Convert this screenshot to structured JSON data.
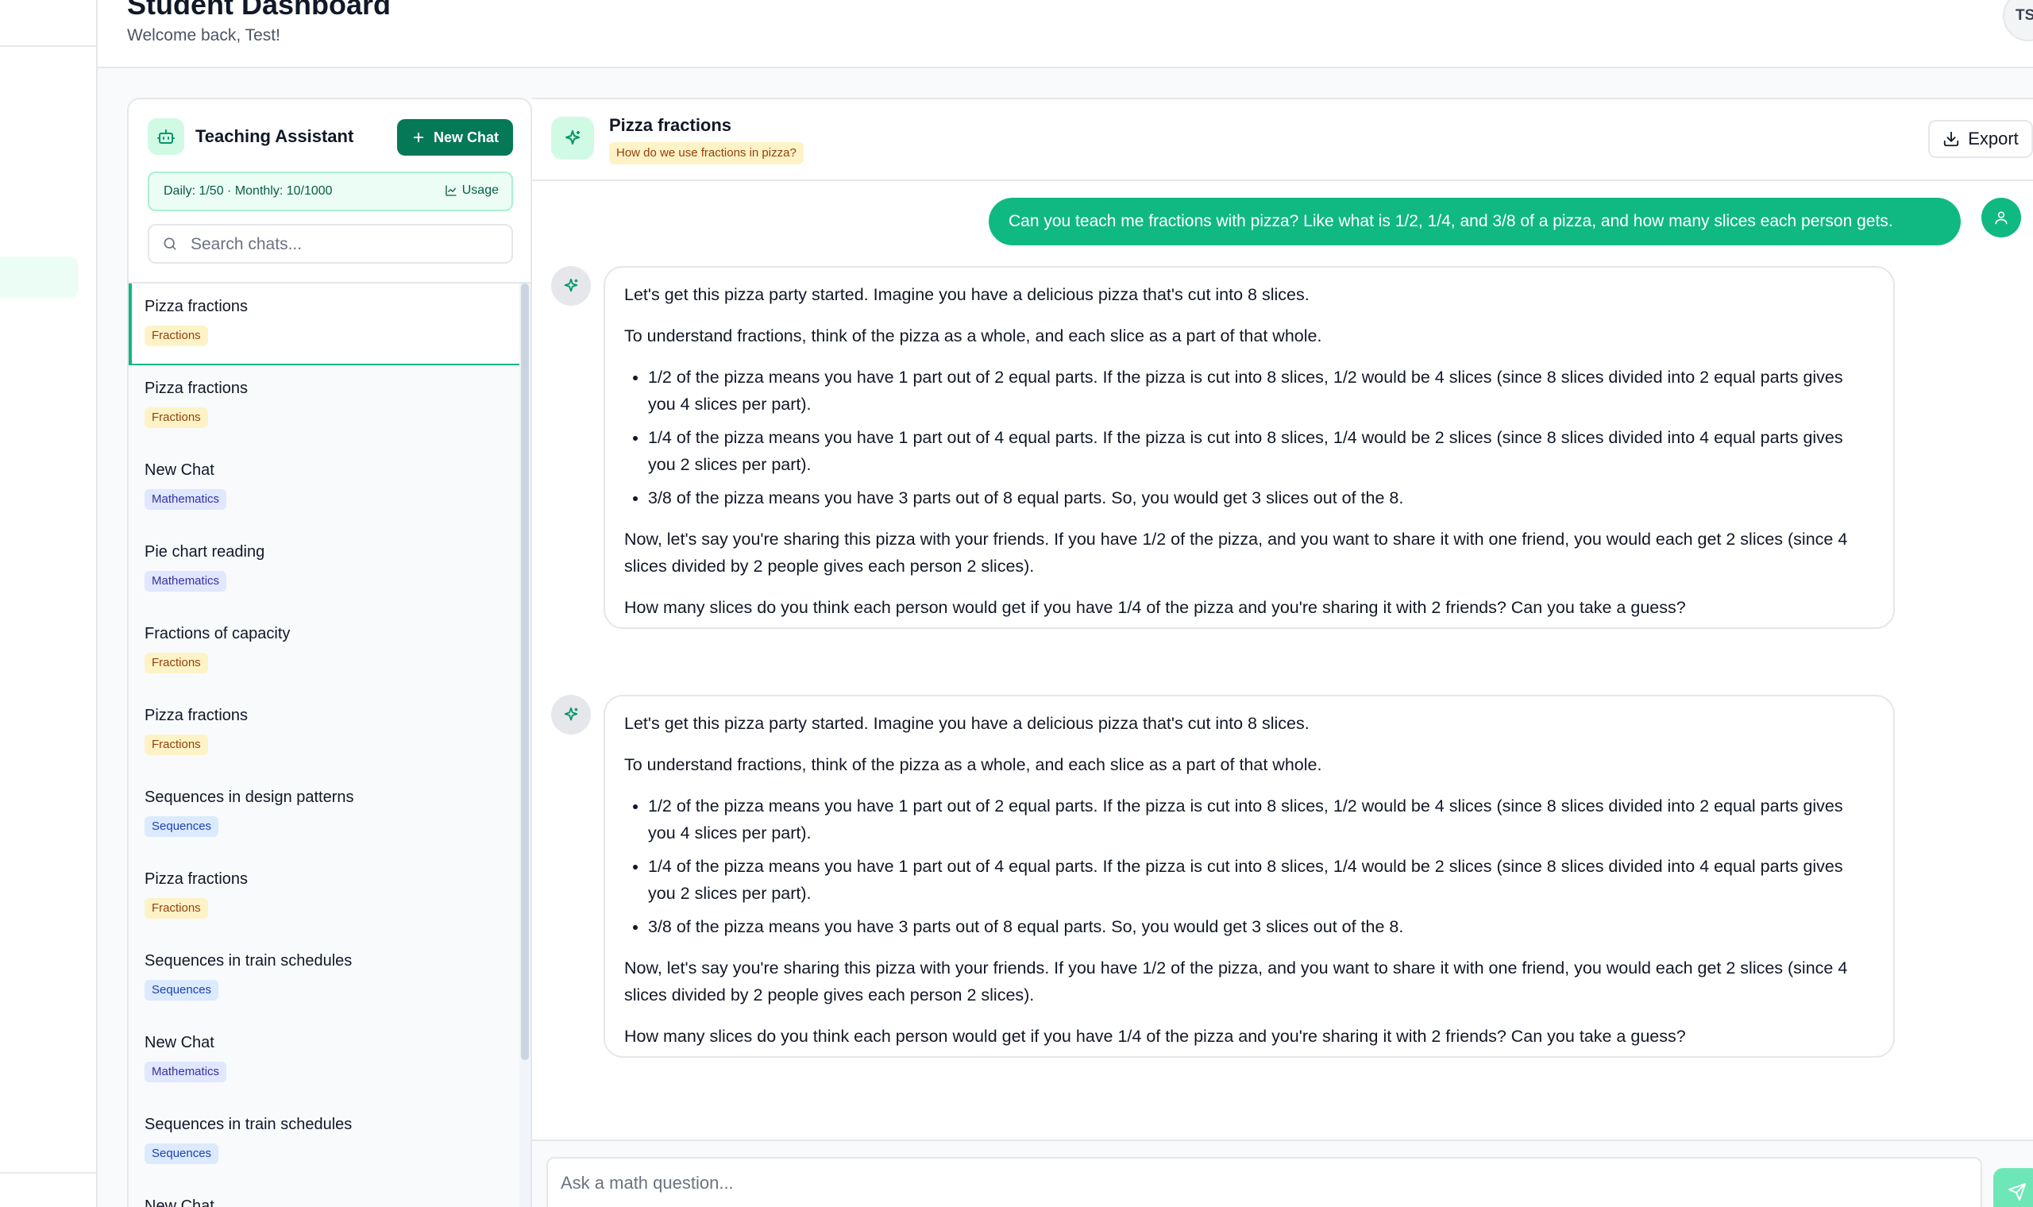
{
  "header": {
    "title": "Student Dashboard",
    "subtitle": "Welcome back, Test!",
    "avatar_initials": "TS"
  },
  "assistant_panel": {
    "title": "Teaching Assistant",
    "new_chat_label": "New Chat",
    "usage_text": "Daily: 1/50 · Monthly: 10/1000",
    "usage_link_label": "Usage",
    "search_placeholder": "Search chats...",
    "chats": [
      {
        "title": "Pizza fractions",
        "tag": "Fractions",
        "tag_type": "fractions",
        "active": true
      },
      {
        "title": "Pizza fractions",
        "tag": "Fractions",
        "tag_type": "fractions"
      },
      {
        "title": "New Chat",
        "tag": "Mathematics",
        "tag_type": "mathematics"
      },
      {
        "title": "Pie chart reading",
        "tag": "Mathematics",
        "tag_type": "mathematics"
      },
      {
        "title": "Fractions of capacity",
        "tag": "Fractions",
        "tag_type": "fractions"
      },
      {
        "title": "Pizza fractions",
        "tag": "Fractions",
        "tag_type": "fractions"
      },
      {
        "title": "Sequences in design patterns",
        "tag": "Sequences",
        "tag_type": "sequences"
      },
      {
        "title": "Pizza fractions",
        "tag": "Fractions",
        "tag_type": "fractions"
      },
      {
        "title": "Sequences in train schedules",
        "tag": "Sequences",
        "tag_type": "sequences"
      },
      {
        "title": "New Chat",
        "tag": "Mathematics",
        "tag_type": "mathematics"
      },
      {
        "title": "Sequences in train schedules",
        "tag": "Sequences",
        "tag_type": "sequences"
      },
      {
        "title": "New Chat",
        "tag": "",
        "tag_type": ""
      }
    ]
  },
  "conversation": {
    "title": "Pizza fractions",
    "topic_tag": "How do we use fractions in pizza?",
    "export_label": "Export",
    "user_message": "Can you teach me fractions with pizza? Like what is 1/2, 1/4, and 3/8 of a pizza, and how many slices each person gets.",
    "assistant_messages": [
      {
        "intro": "Let's get this pizza party started. Imagine you have a delicious pizza that's cut into 8 slices.",
        "para1": "To understand fractions, think of the pizza as a whole, and each slice as a part of that whole.",
        "bullets": [
          "1/2 of the pizza means you have 1 part out of 2 equal parts. If the pizza is cut into 8 slices, 1/2 would be 4 slices (since 8 slices divided into 2 equal parts gives you 4 slices per part).",
          "1/4 of the pizza means you have 1 part out of 4 equal parts. If the pizza is cut into 8 slices, 1/4 would be 2 slices (since 8 slices divided into 4 equal parts gives you 2 slices per part).",
          "3/8 of the pizza means you have 3 parts out of 8 equal parts. So, you would get 3 slices out of the 8."
        ],
        "para2": "Now, let's say you're sharing this pizza with your friends. If you have 1/2 of the pizza, and you want to share it with one friend, you would each get 2 slices (since 4 slices divided by 2 people gives each person 2 slices).",
        "question": "How many slices do you think each person would get if you have 1/4 of the pizza and you're sharing it with 2 friends? Can you take a guess?"
      },
      {
        "intro": "Let's get this pizza party started. Imagine you have a delicious pizza that's cut into 8 slices.",
        "para1": "To understand fractions, think of the pizza as a whole, and each slice as a part of that whole.",
        "bullets": [
          "1/2 of the pizza means you have 1 part out of 2 equal parts. If the pizza is cut into 8 slices, 1/2 would be 4 slices (since 8 slices divided into 2 equal parts gives you 4 slices per part).",
          "1/4 of the pizza means you have 1 part out of 4 equal parts. If the pizza is cut into 8 slices, 1/4 would be 2 slices (since 8 slices divided into 4 equal parts gives you 2 slices per part).",
          "3/8 of the pizza means you have 3 parts out of 8 equal parts. So, you would get 3 slices out of the 8."
        ],
        "para2": "Now, let's say you're sharing this pizza with your friends. If you have 1/2 of the pizza, and you want to share it with one friend, you would each get 2 slices (since 4 slices divided by 2 people gives each person 2 slices).",
        "question": "How many slices do you think each person would get if you have 1/4 of the pizza and you're sharing it with 2 friends? Can you take a guess?"
      }
    ],
    "composer_placeholder": "Ask a math question..."
  },
  "colors": {
    "accent": "#10b981",
    "accent_dark": "#047857",
    "tag_fractions_bg": "#fef3c7",
    "tag_mathematics_bg": "#e0e7ff",
    "tag_sequences_bg": "#dbeafe"
  },
  "icons": {
    "bot": "robot-icon",
    "sparkle": "sparkle-icon",
    "user": "user-icon",
    "plus": "plus-icon",
    "chart": "chart-line-icon",
    "search": "search-icon",
    "download": "download-icon",
    "send": "send-icon"
  }
}
